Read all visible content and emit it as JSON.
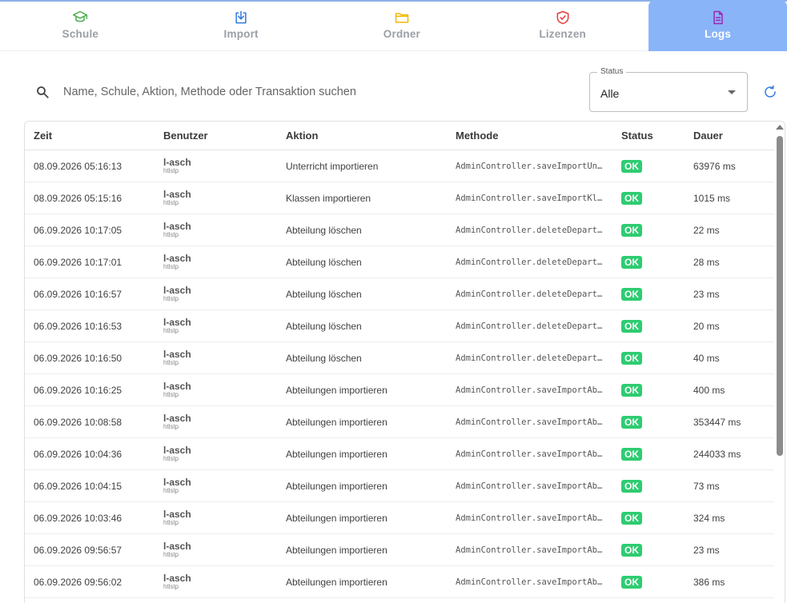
{
  "tabs": [
    {
      "label": "Schule",
      "icon": "school-icon",
      "color": "#4caf50"
    },
    {
      "label": "Import",
      "icon": "import-icon",
      "color": "#2f7be0"
    },
    {
      "label": "Ordner",
      "icon": "folder-icon",
      "color": "#f5b800"
    },
    {
      "label": "Lizenzen",
      "icon": "shield-check-icon",
      "color": "#e53935"
    },
    {
      "label": "Logs",
      "icon": "document-icon",
      "color": "#9c27b0",
      "active": true
    }
  ],
  "search": {
    "placeholder": "Name, Schule, Aktion, Methode oder Transaktion suchen",
    "value": ""
  },
  "status_filter": {
    "legend": "Status",
    "value": "Alle"
  },
  "table": {
    "columns": [
      "Zeit",
      "Benutzer",
      "Aktion",
      "Methode",
      "Status",
      "Dauer"
    ],
    "rows": [
      {
        "zeit": "08.09.2026 05:16:13",
        "user": "l-asch",
        "user_sub": "htlstp",
        "aktion": "Unterricht importieren",
        "methode": "AdminController.saveImportUn…",
        "status": "OK",
        "dauer": "63976 ms"
      },
      {
        "zeit": "08.09.2026 05:15:16",
        "user": "l-asch",
        "user_sub": "htlstp",
        "aktion": "Klassen importieren",
        "methode": "AdminController.saveImportKl…",
        "status": "OK",
        "dauer": "1015 ms"
      },
      {
        "zeit": "06.09.2026 10:17:05",
        "user": "l-asch",
        "user_sub": "htlstp",
        "aktion": "Abteilung löschen",
        "methode": "AdminController.deleteDepart…",
        "status": "OK",
        "dauer": "22 ms"
      },
      {
        "zeit": "06.09.2026 10:17:01",
        "user": "l-asch",
        "user_sub": "htlstp",
        "aktion": "Abteilung löschen",
        "methode": "AdminController.deleteDepart…",
        "status": "OK",
        "dauer": "28 ms"
      },
      {
        "zeit": "06.09.2026 10:16:57",
        "user": "l-asch",
        "user_sub": "htlstp",
        "aktion": "Abteilung löschen",
        "methode": "AdminController.deleteDepart…",
        "status": "OK",
        "dauer": "23 ms"
      },
      {
        "zeit": "06.09.2026 10:16:53",
        "user": "l-asch",
        "user_sub": "htlstp",
        "aktion": "Abteilung löschen",
        "methode": "AdminController.deleteDepart…",
        "status": "OK",
        "dauer": "20 ms"
      },
      {
        "zeit": "06.09.2026 10:16:50",
        "user": "l-asch",
        "user_sub": "htlstp",
        "aktion": "Abteilung löschen",
        "methode": "AdminController.deleteDepart…",
        "status": "OK",
        "dauer": "40 ms"
      },
      {
        "zeit": "06.09.2026 10:16:25",
        "user": "l-asch",
        "user_sub": "htlstp",
        "aktion": "Abteilungen importieren",
        "methode": "AdminController.saveImportAb…",
        "status": "OK",
        "dauer": "400 ms"
      },
      {
        "zeit": "06.09.2026 10:08:58",
        "user": "l-asch",
        "user_sub": "htlstp",
        "aktion": "Abteilungen importieren",
        "methode": "AdminController.saveImportAb…",
        "status": "OK",
        "dauer": "353447 ms"
      },
      {
        "zeit": "06.09.2026 10:04:36",
        "user": "l-asch",
        "user_sub": "htlstp",
        "aktion": "Abteilungen importieren",
        "methode": "AdminController.saveImportAb…",
        "status": "OK",
        "dauer": "244033 ms"
      },
      {
        "zeit": "06.09.2026 10:04:15",
        "user": "l-asch",
        "user_sub": "htlstp",
        "aktion": "Abteilungen importieren",
        "methode": "AdminController.saveImportAb…",
        "status": "OK",
        "dauer": "73 ms"
      },
      {
        "zeit": "06.09.2026 10:03:46",
        "user": "l-asch",
        "user_sub": "htlstp",
        "aktion": "Abteilungen importieren",
        "methode": "AdminController.saveImportAb…",
        "status": "OK",
        "dauer": "324 ms"
      },
      {
        "zeit": "06.09.2026 09:56:57",
        "user": "l-asch",
        "user_sub": "htlstp",
        "aktion": "Abteilungen importieren",
        "methode": "AdminController.saveImportAb…",
        "status": "OK",
        "dauer": "23 ms"
      },
      {
        "zeit": "06.09.2026 09:56:02",
        "user": "l-asch",
        "user_sub": "htlstp",
        "aktion": "Abteilungen importieren",
        "methode": "AdminController.saveImportAb…",
        "status": "OK",
        "dauer": "386 ms"
      }
    ]
  },
  "colors": {
    "accent": "#8ab4f8",
    "ok_badge": "#2ecc71",
    "refresh_icon": "#2f7be0"
  }
}
